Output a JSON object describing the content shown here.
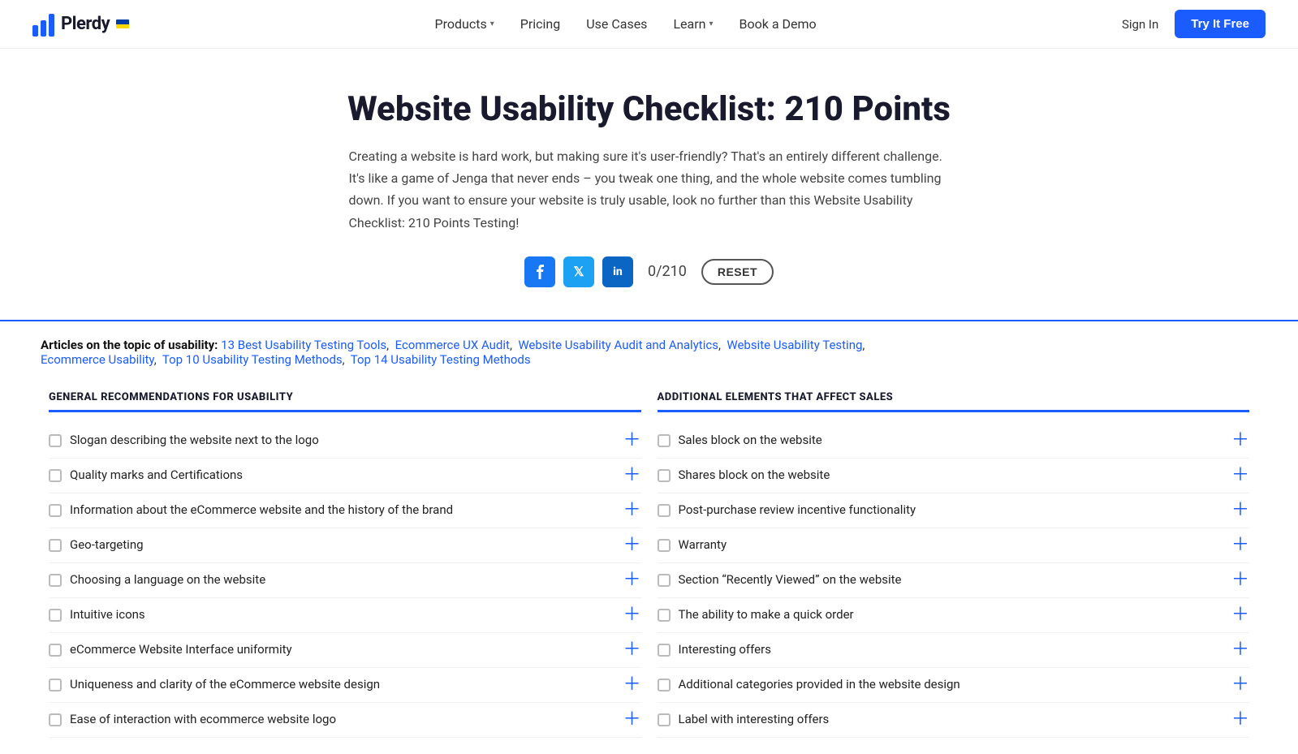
{
  "header": {
    "logo_text": "Plerdy",
    "nav": [
      {
        "id": "products",
        "label": "Products",
        "has_dropdown": true
      },
      {
        "id": "pricing",
        "label": "Pricing",
        "has_dropdown": false
      },
      {
        "id": "use-cases",
        "label": "Use Cases",
        "has_dropdown": false
      },
      {
        "id": "learn",
        "label": "Learn",
        "has_dropdown": true
      },
      {
        "id": "book-demo",
        "label": "Book a Demo",
        "has_dropdown": false
      }
    ],
    "sign_in_label": "Sign In",
    "try_free_label": "Try It Free"
  },
  "hero": {
    "title": "Website Usability Checklist: 210 Points",
    "description": "Creating a website is hard work, but making sure it's user-friendly? That's an entirely different challenge. It's like a game of Jenga that never ends – you tweak one thing, and the whole website comes tumbling down. If you want to ensure your website is truly usable, look no further than this Website Usability Checklist: 210 Points Testing!",
    "counter": "0/210",
    "reset_label": "RESET"
  },
  "articles": {
    "prefix": "Articles on the topic of usability:",
    "links": [
      "13 Best Usability Testing Tools",
      "Ecommerce UX Audit",
      "Website Usability Audit and Analytics",
      "Website Usability Testing",
      "Ecommerce Usability",
      "Top 10 Usability Testing Methods",
      "Top 14 Usability Testing Methods"
    ]
  },
  "checklist_left": {
    "title": "GENERAL RECOMMENDATIONS FOR USABILITY",
    "items": [
      "Slogan describing the website next to the logo",
      "Quality marks and Certifications",
      "Information about the eCommerce website and the history of the brand",
      "Geo-targeting",
      "Choosing a language on the website",
      "Intuitive icons",
      "eCommerce Website Interface uniformity",
      "Uniqueness and clarity of the eCommerce website design",
      "Ease of interaction with ecommerce website logo"
    ]
  },
  "checklist_right": {
    "title": "ADDITIONAL ELEMENTS THAT AFFECT SALES",
    "items": [
      "Sales block on the website",
      "Shares block on the website",
      "Post-purchase review incentive functionality",
      "Warranty",
      "Section “Recently Viewed” on the website",
      "The ability to make a quick order",
      "Interesting offers",
      "Additional categories provided in the website design",
      "Label with interesting offers"
    ]
  },
  "colors": {
    "accent": "#1a5cff",
    "text_dark": "#1a1a2e",
    "text_mid": "#444"
  }
}
